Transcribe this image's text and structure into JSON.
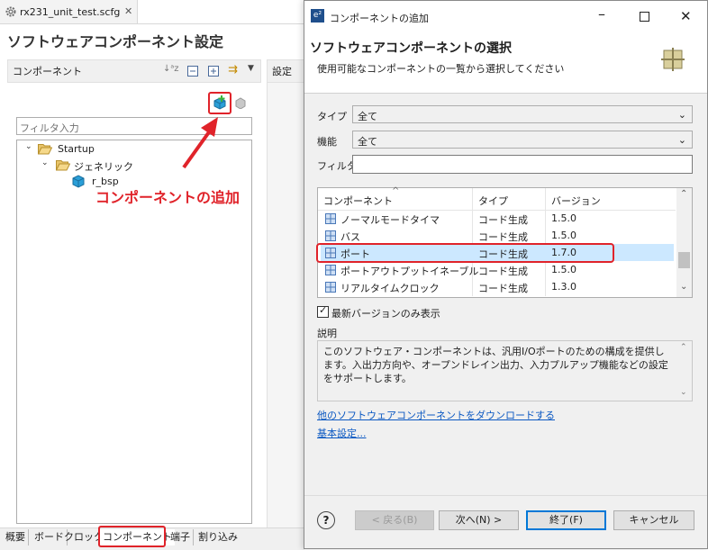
{
  "editor": {
    "tab_title": "rx231_unit_test.scfg",
    "page_title": "ソフトウェアコンポーネント設定",
    "components_header": "コンポーネント",
    "settings_header": "設定",
    "filter_placeholder": "フィルタ入力",
    "tree": [
      {
        "label": "Startup"
      },
      {
        "label": "ジェネリック"
      },
      {
        "label": "r_bsp"
      }
    ],
    "callout_text": "コンポーネントの追加",
    "bottom_tabs": [
      "概要",
      "ボード",
      "クロック",
      "コンポーネント",
      "端子",
      "割り込み"
    ]
  },
  "dialog": {
    "window_title": "コンポーネントの追加",
    "heading": "ソフトウェアコンポーネントの選択",
    "subheading": "使用可能なコンポーネントの一覧から選択してください",
    "type_label": "タイプ",
    "type_value": "全て",
    "function_label": "機能",
    "function_value": "全て",
    "filter_label": "フィルタ",
    "filter_value": "",
    "columns": [
      "コンポーネント",
      "タイプ",
      "バージョン"
    ],
    "rows": [
      {
        "name": "ノーマルモードタイマ",
        "type": "コード生成",
        "version": "1.5.0"
      },
      {
        "name": "バス",
        "type": "コード生成",
        "version": "1.5.0"
      },
      {
        "name": "ポート",
        "type": "コード生成",
        "version": "1.7.0"
      },
      {
        "name": "ポートアウトプットイネーブル",
        "type": "コード生成",
        "version": "1.5.0"
      },
      {
        "name": "リアルタイムクロック",
        "type": "コード生成",
        "version": "1.3.0"
      }
    ],
    "latest_only_label": "最新バージョンのみ表示",
    "latest_only_checked": true,
    "description_label": "説明",
    "description_text": "このソフトウェア・コンポーネントは、汎用I/Oポートのための構成を提供します。入出力方向や、オープンドレイン出力、入力プルアップ機能などの設定をサポートします。",
    "download_link": "他のソフトウェアコンポーネントをダウンロードする",
    "basic_settings_link": "基本設定...",
    "buttons": {
      "back": "< 戻る(B)",
      "next": "次へ(N) >",
      "finish": "終了(F)",
      "cancel": "キャンセル"
    }
  },
  "colors": {
    "highlight_red": "#e0232a",
    "selection_blue": "#cce8ff",
    "link_blue": "#0b58c2"
  }
}
